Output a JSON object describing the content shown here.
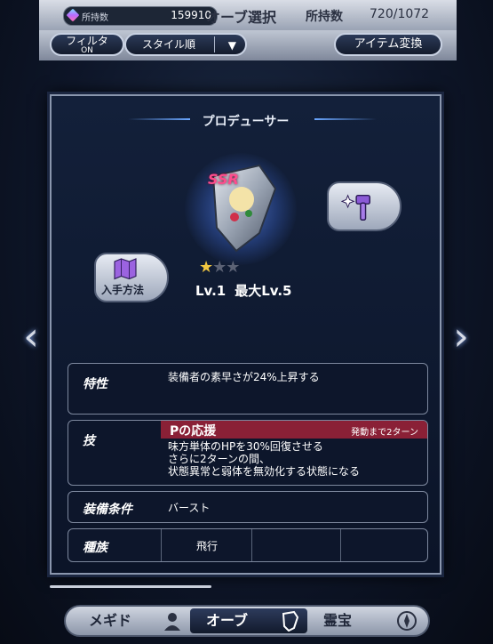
{
  "header": {
    "gems_label": "所持数",
    "gems_value": "159910",
    "title": "オーブ選択",
    "owned_label": "所持数",
    "owned_value": "720/1072"
  },
  "controls": {
    "filter_label": "フィルタ",
    "filter_state": "ON",
    "sort_label": "スタイル順",
    "exchange_label": "アイテム変換"
  },
  "detail": {
    "title": "プロデューサー",
    "rarity": "SSR",
    "source_label": "入手方法",
    "stars": {
      "filled": 1,
      "total": 3
    },
    "level": "Lv.1",
    "max_level": "最大Lv.5",
    "trait": {
      "label": "特性",
      "text": "装備者の素早さが24%上昇する"
    },
    "skill": {
      "label": "技",
      "name": "Pの応援",
      "cooldown": "発動まで2ターン",
      "desc1": "味方単体のHPを30%回復させる",
      "desc2": "さらに2ターンの間、",
      "desc3": "状態異常と弱体を無効化する状態になる"
    },
    "equip": {
      "label": "装備条件",
      "value": "バースト"
    },
    "tribe": {
      "label": "種族",
      "values": [
        "飛行",
        "",
        ""
      ]
    }
  },
  "tabs": {
    "megido": "メギド",
    "orb": "オーブ",
    "treasure": "霊宝"
  },
  "colors": {
    "accent": "#8a2036",
    "rarity": "#ff4d8d",
    "star": "#f0c640"
  }
}
